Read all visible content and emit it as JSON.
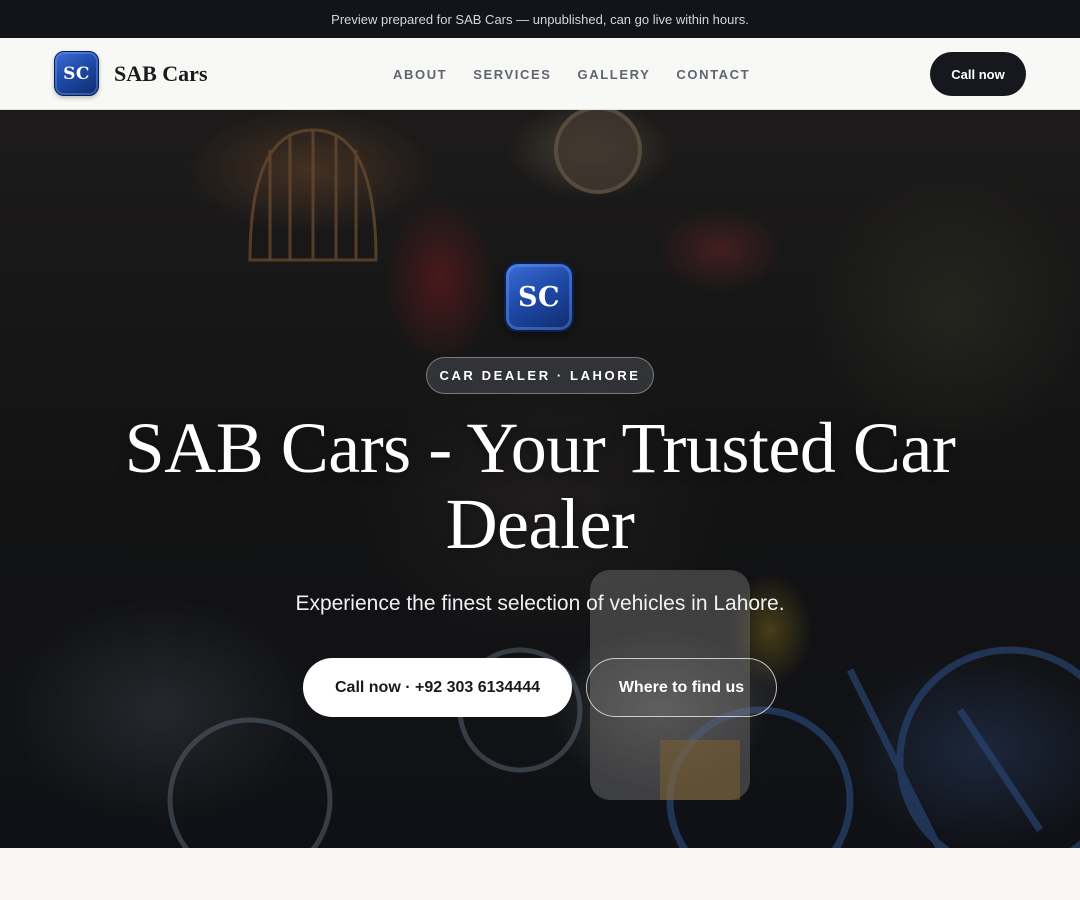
{
  "preview_bar": {
    "text": "Preview prepared for SAB Cars — unpublished, can go live within hours."
  },
  "header": {
    "logo_text": "SC",
    "brand_name": "SAB Cars",
    "nav": [
      {
        "label": "ABOUT"
      },
      {
        "label": "SERVICES"
      },
      {
        "label": "GALLERY"
      },
      {
        "label": "CONTACT"
      }
    ],
    "cta_label": "Call now"
  },
  "hero": {
    "logo_text": "SC",
    "badge": "CAR DEALER · LAHORE",
    "title": "SAB Cars - Your Trusted Car Dealer",
    "subtitle": "Experience the finest selection of vehicles in Lahore.",
    "primary_button": "Call now · +92 303 6134444",
    "secondary_button": "Where to find us",
    "background_image": "shop-interior-with-bicycles-photo"
  },
  "colors": {
    "preview_bar_bg": "#121419",
    "nav_cta_bg": "#16181d",
    "logo_blue": "#1f4aa8",
    "nav_link": "#5e6570",
    "page_bg": "#f8f7f4"
  }
}
